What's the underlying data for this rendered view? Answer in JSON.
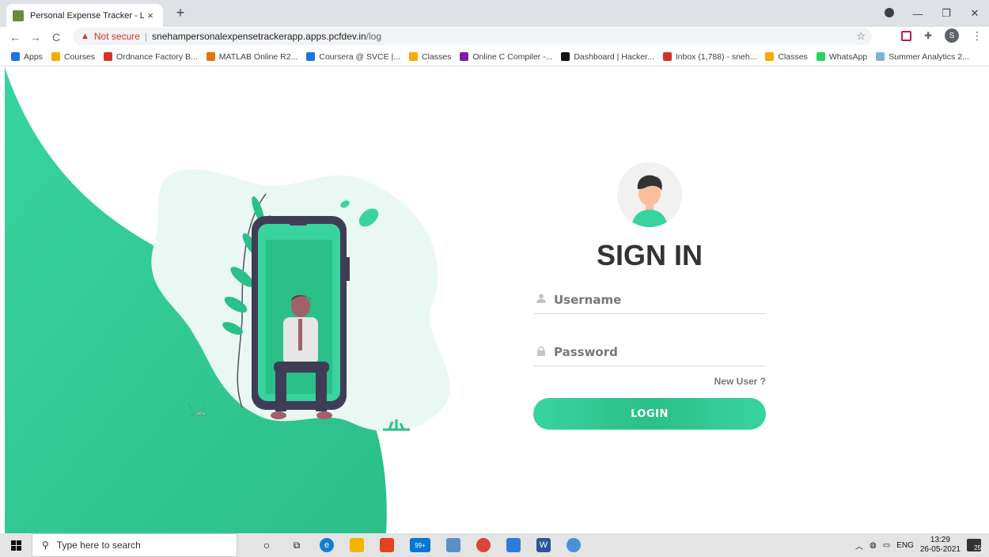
{
  "browser": {
    "tab_title": "Personal Expense Tracker - Login",
    "tab_close": "×",
    "new_tab": "+",
    "not_secure": "Not secure",
    "url_host": "snehampersonalexpensetrackerapp.apps.pcfdev.in",
    "url_path": "/log",
    "profile_initial": "S"
  },
  "bookmarks": [
    {
      "label": "Apps",
      "color": "#1a73e8"
    },
    {
      "label": "Courses",
      "color": "#f9ab00"
    },
    {
      "label": "Ordnance Factory B...",
      "color": "#d93025"
    },
    {
      "label": "MATLAB Online R2...",
      "color": "#e8710a"
    },
    {
      "label": "Coursera @ SVCE |...",
      "color": "#1a73e8"
    },
    {
      "label": "Classes",
      "color": "#f9ab00"
    },
    {
      "label": "Online C Compiler -...",
      "color": "#7b1fa2"
    },
    {
      "label": "Dashboard | Hacker...",
      "color": "#111111"
    },
    {
      "label": "Inbox (1,788) - sneh...",
      "color": "#d93025"
    },
    {
      "label": "Classes",
      "color": "#f9ab00"
    },
    {
      "label": "WhatsApp",
      "color": "#25d366"
    },
    {
      "label": "Summer Analytics 2...",
      "color": "#7fb3d5"
    }
  ],
  "login": {
    "title": "SIGN IN",
    "username_placeholder": "Username",
    "password_placeholder": "Password",
    "new_user": "New User ?",
    "login_button": "LOGIN"
  },
  "taskbar": {
    "search_placeholder": "Type here to search",
    "language": "ENG",
    "time": "13:29",
    "date": "26-05-2021",
    "notifications": "25",
    "store_badge": "99+"
  },
  "colors": {
    "accent": "#38d39f",
    "accent_dark": "#2bbf8a"
  }
}
